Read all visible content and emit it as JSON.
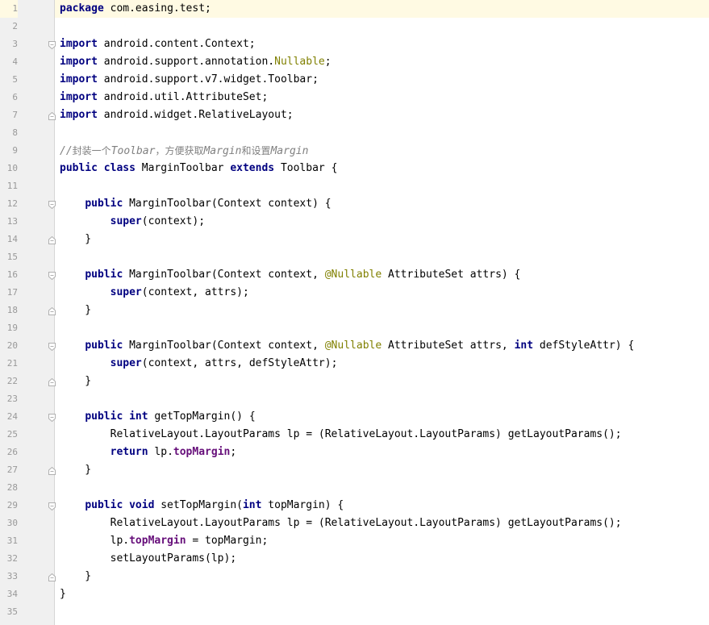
{
  "colors": {
    "keyword": "#000080",
    "annotation": "#808000",
    "field": "#660e7a",
    "comment": "#808080",
    "gutter": "#f0f0f0",
    "current_line": "#fffae3"
  },
  "editor": {
    "current_line": 1,
    "lines": [
      {
        "num": "1",
        "fold": null,
        "tokens": [
          {
            "t": "package",
            "c": "kw"
          },
          {
            "t": " com.easing.test;",
            "c": ""
          }
        ]
      },
      {
        "num": "2",
        "fold": null,
        "tokens": []
      },
      {
        "num": "3",
        "fold": "fold-open",
        "tokens": [
          {
            "t": "import",
            "c": "kw"
          },
          {
            "t": " android.content.Context;",
            "c": ""
          }
        ]
      },
      {
        "num": "4",
        "fold": null,
        "tokens": [
          {
            "t": "import",
            "c": "kw"
          },
          {
            "t": " android.support.annotation.",
            "c": ""
          },
          {
            "t": "Nullable",
            "c": "ann"
          },
          {
            "t": ";",
            "c": ""
          }
        ]
      },
      {
        "num": "5",
        "fold": null,
        "tokens": [
          {
            "t": "import",
            "c": "kw"
          },
          {
            "t": " android.support.v7.widget.Toolbar;",
            "c": ""
          }
        ]
      },
      {
        "num": "6",
        "fold": null,
        "tokens": [
          {
            "t": "import",
            "c": "kw"
          },
          {
            "t": " android.util.AttributeSet;",
            "c": ""
          }
        ]
      },
      {
        "num": "7",
        "fold": "fold-close",
        "tokens": [
          {
            "t": "import",
            "c": "kw"
          },
          {
            "t": " android.widget.RelativeLayout;",
            "c": ""
          }
        ]
      },
      {
        "num": "8",
        "fold": null,
        "tokens": []
      },
      {
        "num": "9",
        "fold": null,
        "tokens": [
          {
            "t": "//",
            "c": "cmt"
          },
          {
            "t": "封装一个",
            "c": "cmt cmt-cn"
          },
          {
            "t": "Toolbar",
            "c": "cmt"
          },
          {
            "t": "，方便获取",
            "c": "cmt cmt-cn"
          },
          {
            "t": "Margin",
            "c": "cmt"
          },
          {
            "t": "和设置",
            "c": "cmt cmt-cn"
          },
          {
            "t": "Margin",
            "c": "cmt"
          }
        ]
      },
      {
        "num": "10",
        "fold": null,
        "tokens": [
          {
            "t": "public class",
            "c": "kw"
          },
          {
            "t": " MarginToolbar ",
            "c": ""
          },
          {
            "t": "extends",
            "c": "kw"
          },
          {
            "t": " Toolbar {",
            "c": ""
          }
        ]
      },
      {
        "num": "11",
        "fold": null,
        "tokens": []
      },
      {
        "num": "12",
        "fold": "fold-open",
        "tokens": [
          {
            "t": "    ",
            "c": ""
          },
          {
            "t": "public",
            "c": "kw"
          },
          {
            "t": " MarginToolbar(Context context) {",
            "c": ""
          }
        ]
      },
      {
        "num": "13",
        "fold": null,
        "tokens": [
          {
            "t": "        ",
            "c": ""
          },
          {
            "t": "super",
            "c": "kw"
          },
          {
            "t": "(context);",
            "c": ""
          }
        ]
      },
      {
        "num": "14",
        "fold": "fold-close",
        "tokens": [
          {
            "t": "    }",
            "c": ""
          }
        ]
      },
      {
        "num": "15",
        "fold": null,
        "tokens": []
      },
      {
        "num": "16",
        "fold": "fold-open",
        "tokens": [
          {
            "t": "    ",
            "c": ""
          },
          {
            "t": "public",
            "c": "kw"
          },
          {
            "t": " MarginToolbar(Context context, ",
            "c": ""
          },
          {
            "t": "@Nullable",
            "c": "ann"
          },
          {
            "t": " AttributeSet attrs) {",
            "c": ""
          }
        ]
      },
      {
        "num": "17",
        "fold": null,
        "tokens": [
          {
            "t": "        ",
            "c": ""
          },
          {
            "t": "super",
            "c": "kw"
          },
          {
            "t": "(context, attrs);",
            "c": ""
          }
        ]
      },
      {
        "num": "18",
        "fold": "fold-close",
        "tokens": [
          {
            "t": "    }",
            "c": ""
          }
        ]
      },
      {
        "num": "19",
        "fold": null,
        "tokens": []
      },
      {
        "num": "20",
        "fold": "fold-open",
        "tokens": [
          {
            "t": "    ",
            "c": ""
          },
          {
            "t": "public",
            "c": "kw"
          },
          {
            "t": " MarginToolbar(Context context, ",
            "c": ""
          },
          {
            "t": "@Nullable",
            "c": "ann"
          },
          {
            "t": " AttributeSet attrs, ",
            "c": ""
          },
          {
            "t": "int",
            "c": "kw"
          },
          {
            "t": " defStyleAttr) {",
            "c": ""
          }
        ]
      },
      {
        "num": "21",
        "fold": null,
        "tokens": [
          {
            "t": "        ",
            "c": ""
          },
          {
            "t": "super",
            "c": "kw"
          },
          {
            "t": "(context, attrs, defStyleAttr);",
            "c": ""
          }
        ]
      },
      {
        "num": "22",
        "fold": "fold-close",
        "tokens": [
          {
            "t": "    }",
            "c": ""
          }
        ]
      },
      {
        "num": "23",
        "fold": null,
        "tokens": []
      },
      {
        "num": "24",
        "fold": "fold-open",
        "tokens": [
          {
            "t": "    ",
            "c": ""
          },
          {
            "t": "public int",
            "c": "kw"
          },
          {
            "t": " getTopMargin() {",
            "c": ""
          }
        ]
      },
      {
        "num": "25",
        "fold": null,
        "tokens": [
          {
            "t": "        RelativeLayout.LayoutParams lp = (RelativeLayout.LayoutParams) getLayoutParams();",
            "c": ""
          }
        ]
      },
      {
        "num": "26",
        "fold": null,
        "tokens": [
          {
            "t": "        ",
            "c": ""
          },
          {
            "t": "return",
            "c": "kw"
          },
          {
            "t": " lp.",
            "c": ""
          },
          {
            "t": "topMargin",
            "c": "fld"
          },
          {
            "t": ";",
            "c": ""
          }
        ]
      },
      {
        "num": "27",
        "fold": "fold-close",
        "tokens": [
          {
            "t": "    }",
            "c": ""
          }
        ]
      },
      {
        "num": "28",
        "fold": null,
        "tokens": []
      },
      {
        "num": "29",
        "fold": "fold-open",
        "tokens": [
          {
            "t": "    ",
            "c": ""
          },
          {
            "t": "public void",
            "c": "kw"
          },
          {
            "t": " setTopMargin(",
            "c": ""
          },
          {
            "t": "int",
            "c": "kw"
          },
          {
            "t": " topMargin) {",
            "c": ""
          }
        ]
      },
      {
        "num": "30",
        "fold": null,
        "tokens": [
          {
            "t": "        RelativeLayout.LayoutParams lp = (RelativeLayout.LayoutParams) getLayoutParams();",
            "c": ""
          }
        ]
      },
      {
        "num": "31",
        "fold": null,
        "tokens": [
          {
            "t": "        lp.",
            "c": ""
          },
          {
            "t": "topMargin",
            "c": "fld"
          },
          {
            "t": " = topMargin;",
            "c": ""
          }
        ]
      },
      {
        "num": "32",
        "fold": null,
        "tokens": [
          {
            "t": "        setLayoutParams(lp);",
            "c": ""
          }
        ]
      },
      {
        "num": "33",
        "fold": "fold-close",
        "tokens": [
          {
            "t": "    }",
            "c": ""
          }
        ]
      },
      {
        "num": "34",
        "fold": null,
        "tokens": [
          {
            "t": "}",
            "c": ""
          }
        ]
      },
      {
        "num": "35",
        "fold": null,
        "tokens": []
      }
    ]
  }
}
